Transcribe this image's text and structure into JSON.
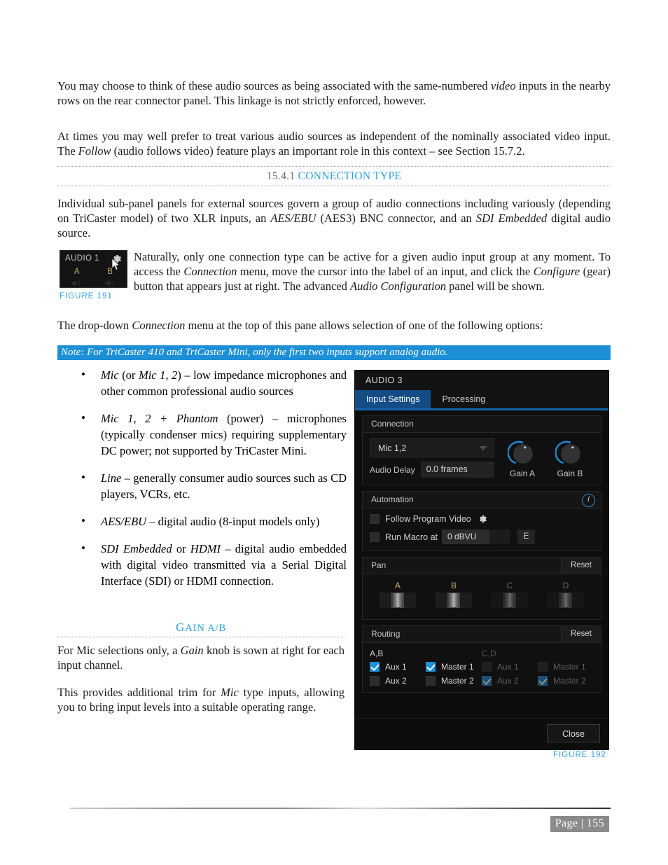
{
  "colors": {
    "accent_blue": "#2f9fdc",
    "note_bar_blue": "#1c8fd6",
    "panel_bg": "#0d0d0d",
    "tab_active_blue": "#144c86",
    "tab_underline_blue": "#1464a8",
    "pan_label_tan": "#c9a978"
  },
  "paragraphs": {
    "p1_a": "You may choose to think of these audio sources as being associated with the same-numbered ",
    "p1_video": "video",
    "p1_b": " inputs in the nearby rows on the rear connector panel. This linkage is not strictly enforced, however.",
    "p2_a": "At times you may well prefer to treat various audio sources as independent of the nominally associated video input.  The ",
    "p2_follow": "Follow",
    "p2_b": " (audio follows video) feature plays an important role in this context – see Section 15.7.2.",
    "p3_a": "Individual sub-panel panels for external sources govern a group of audio connections including variously (depending on TriCaster model) of two XLR inputs, an ",
    "p3_aesebu": "AES/EBU",
    "p3_b": " (AES3) BNC connector, and an ",
    "p3_sdi": "SDI Embedded",
    "p3_c": " digital audio source.",
    "p4_a": "Naturally, only one connection type can be active for a given audio input group at any moment. To access the ",
    "p4_connection": "Connection",
    "p4_b": " menu, move the cursor into the label of an input, and click the ",
    "p4_configure": "Configure",
    "p4_c": " (gear) button that appears just at right. The advanced ",
    "p4_audioconfig": "Audio Configuration",
    "p4_d": " panel will be shown.",
    "p5_a": "The drop-down ",
    "p5_connection": "Connection",
    "p5_b": " menu at the top of this pane allows selection of one of the following options:",
    "p6_a": "For Mic selections only, a ",
    "p6_gain": "Gain",
    "p6_b": " knob is sown at right for each input channel.",
    "p7_a": "This provides additional trim for ",
    "p7_mic": "Mic",
    "p7_b": " type inputs, allowing you to bring input levels into a suitable operating range."
  },
  "headings": {
    "section_number": "15.4.1",
    "section_title": "CONNECTION TYPE",
    "sub_gain_cap": "G",
    "sub_gain_rest": "AIN",
    "sub_gain_ab": " A/B"
  },
  "note": {
    "text": "Note: For TriCaster 410 and TriCaster Mini, only the first two inputs support analog audio."
  },
  "bullets": [
    {
      "lead": "Mic",
      "mid": " (or ",
      "lead2": "Mic 1, 2",
      "rest": ") – low impedance microphones and other common professional audio sources"
    },
    {
      "lead": "Mic 1, 2 + Phantom",
      "rest": " (power) – microphones (typically condenser mics) requiring supplementary DC power; not supported by TriCaster Mini."
    },
    {
      "lead": "Line",
      "rest": " – generally consumer audio sources such as CD players, VCRs, etc."
    },
    {
      "lead": "AES/EBU",
      "rest": " – digital audio (8-input models only)"
    },
    {
      "lead": "SDI Embedded",
      "mid": " or ",
      "lead2": "HDMI",
      "rest": " – digital audio embedded with digital video transmitted via a Serial Digital Interface (SDI) or HDMI connection."
    }
  ],
  "figure191": {
    "caption": "FIGURE 191",
    "title": "AUDIO 1",
    "channel_a": "A",
    "channel_b": "B"
  },
  "figure192": {
    "caption": "FIGURE 192",
    "panel_title": "AUDIO 3",
    "tabs": [
      {
        "label": "Input Settings",
        "active": true
      },
      {
        "label": "Processing",
        "active": false
      }
    ],
    "connection": {
      "group_label": "Connection",
      "dropdown_value": "Mic 1,2",
      "delay_label": "Audio Delay",
      "delay_value": "0.0 frames",
      "knob_a_label": "Gain A",
      "knob_b_label": "Gain B"
    },
    "automation": {
      "group_label": "Automation",
      "info_glyph": "i",
      "follow_label": "Follow Program Video",
      "follow_checked": false,
      "macro_label": "Run Macro at",
      "macro_checked": false,
      "macro_value": "0 dBVU",
      "macro_button": "E"
    },
    "pan": {
      "group_label": "Pan",
      "reset_label": "Reset",
      "channels": [
        {
          "label": "A",
          "enabled": true
        },
        {
          "label": "B",
          "enabled": true
        },
        {
          "label": "C",
          "enabled": false
        },
        {
          "label": "D",
          "enabled": false
        }
      ]
    },
    "routing": {
      "group_label": "Routing",
      "reset_label": "Reset",
      "columns": [
        {
          "title": "A,B",
          "enabled": true,
          "items": [
            {
              "label": "Aux 1",
              "checked": true
            },
            {
              "label": "Master 1",
              "checked": true
            },
            {
              "label": "Aux 2",
              "checked": false
            },
            {
              "label": "Master 2",
              "checked": false
            }
          ]
        },
        {
          "title": "C,D",
          "enabled": false,
          "items": [
            {
              "label": "Aux 1",
              "checked": false
            },
            {
              "label": "Master 1",
              "checked": false
            },
            {
              "label": "Aux 2",
              "checked": true
            },
            {
              "label": "Master 2",
              "checked": true
            }
          ]
        }
      ]
    },
    "close_label": "Close"
  },
  "page_footer": {
    "page_label": "Page | 155"
  }
}
